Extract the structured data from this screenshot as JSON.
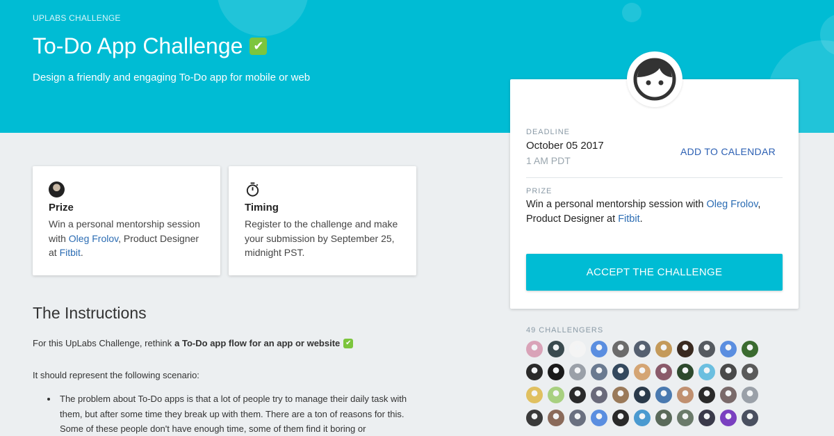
{
  "hero": {
    "kicker": "UPLABS CHALLENGE",
    "title": "To-Do App Challenge",
    "title_emoji": "✔",
    "subtitle": "Design a friendly and engaging To-Do app for mobile or web",
    "color": "#00bcd4"
  },
  "prize_card": {
    "icon": "avatar-icon",
    "title": "Prize",
    "body_pre": "Win a personal mentorship session with ",
    "link1": "Oleg Frolov",
    "body_mid": ", Product Designer at ",
    "link2": "Fitbit",
    "body_post": "."
  },
  "timing_card": {
    "icon": "stopwatch-icon",
    "title": "Timing",
    "body": "Register to the challenge and make your submission by September 25, midnight PST."
  },
  "instructions": {
    "title": "The Instructions",
    "p1_pre": "For this UpLabs Challenge, rethink",
    "p1_bold": "a To-Do app flow for an app or website",
    "p1_emoji": "✔",
    "p2": "It should represent the following scenario:",
    "bullet1": "The problem about To-Do apps is that a lot of people try to manage their daily task with them, but after some time they break up with them. There are a ton of reasons for this. Some of these people don't have enough time, some of them find it boring or"
  },
  "side_card": {
    "deadline_label": "DEADLINE",
    "deadline_date": "October 05 2017",
    "deadline_time": "1 AM PDT",
    "add_to_calendar": "ADD TO CALENDAR",
    "prize_label": "PRIZE",
    "prize_pre": "Win a personal mentorship session with ",
    "prize_link1": "Oleg Frolov",
    "prize_mid": ", Product Designer at ",
    "prize_link2": "Fitbit",
    "prize_post": ".",
    "accept_button": "ACCEPT THE CHALLENGE"
  },
  "challengers": {
    "label": "49 CHALLENGERS",
    "avatar_colors": [
      "#d9a3b8",
      "#3a4a4f",
      "#f4f4f4",
      "#5a8ee0",
      "#6b6b6b",
      "#556070",
      "#c49a5a",
      "#3a2a20",
      "#555a60",
      "#5a8ee0",
      "#3b6b30",
      "#2a2a2a",
      "#1a1a1a",
      "#9aa0a8",
      "#6a7a90",
      "#34495e",
      "#d4a574",
      "#8a5a6a",
      "#2d4a2d",
      "#6bbfe0",
      "#4a4a4a",
      "#5a5a5a",
      "#e0c060",
      "#a8d080",
      "#2a2a2a",
      "#6a6a7a",
      "#9a7a5a",
      "#2a3a4a",
      "#4a7ab0",
      "#c09070",
      "#2a2a2a",
      "#7a6a6a",
      "#9aa0a8",
      "#3a3a3a",
      "#8a6a5a",
      "#6a7080",
      "#5a8ee0",
      "#2a2a2a",
      "#4a9ad0",
      "#5a6a5a",
      "#6a7a6a",
      "#3a3a4a",
      "#7a40c0",
      "#4a5060"
    ]
  }
}
